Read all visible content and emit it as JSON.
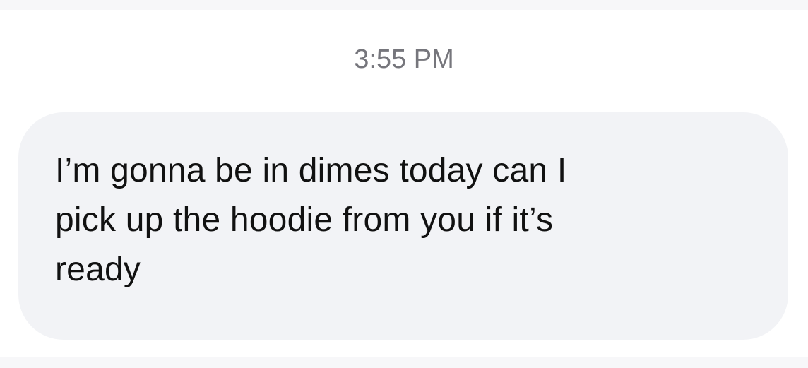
{
  "conversation": {
    "timestamp": "3:55 PM",
    "messages": [
      {
        "direction": "incoming",
        "text": "I’m gonna be in dimes today can I\npick up the hoodie from you if it’s\nready"
      }
    ]
  },
  "colors": {
    "background": "#ffffff",
    "bubble": "#f2f3f6",
    "timestamp_text": "#76767c",
    "message_text": "#111111"
  }
}
